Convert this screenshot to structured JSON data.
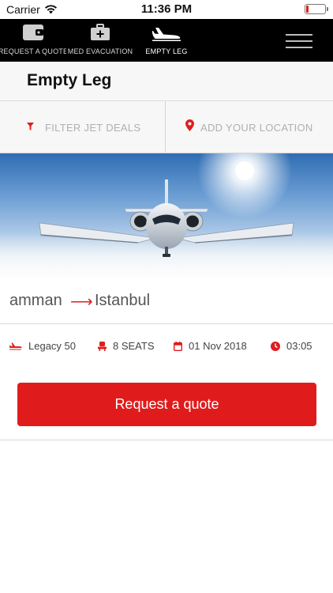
{
  "status_bar": {
    "carrier": "Carrier",
    "time": "11:36 PM",
    "battery_level": 0.12
  },
  "nav": {
    "tabs": [
      {
        "label": "REQUEST A QUOTE",
        "icon": "wallet-icon"
      },
      {
        "label": "MED EVACUATION",
        "icon": "medical-kit-icon"
      },
      {
        "label": "EMPTY LEG",
        "icon": "airplane-icon",
        "active": true
      }
    ],
    "menu_icon": "hamburger-menu-icon"
  },
  "page": {
    "title": "Empty Leg"
  },
  "filters": {
    "filter_label": "FILTER JET DEALS",
    "location_label": "ADD YOUR LOCATION"
  },
  "deal": {
    "from": "amman",
    "to": "Istanbul",
    "aircraft": "Legacy 50",
    "seats": "8 SEATS",
    "date": "01 Nov 2018",
    "time": "03:05",
    "cta_label": "Request a quote"
  },
  "colors": {
    "accent": "#e01b1b",
    "nav_background": "#000000",
    "header_background": "#f7f7f7"
  }
}
